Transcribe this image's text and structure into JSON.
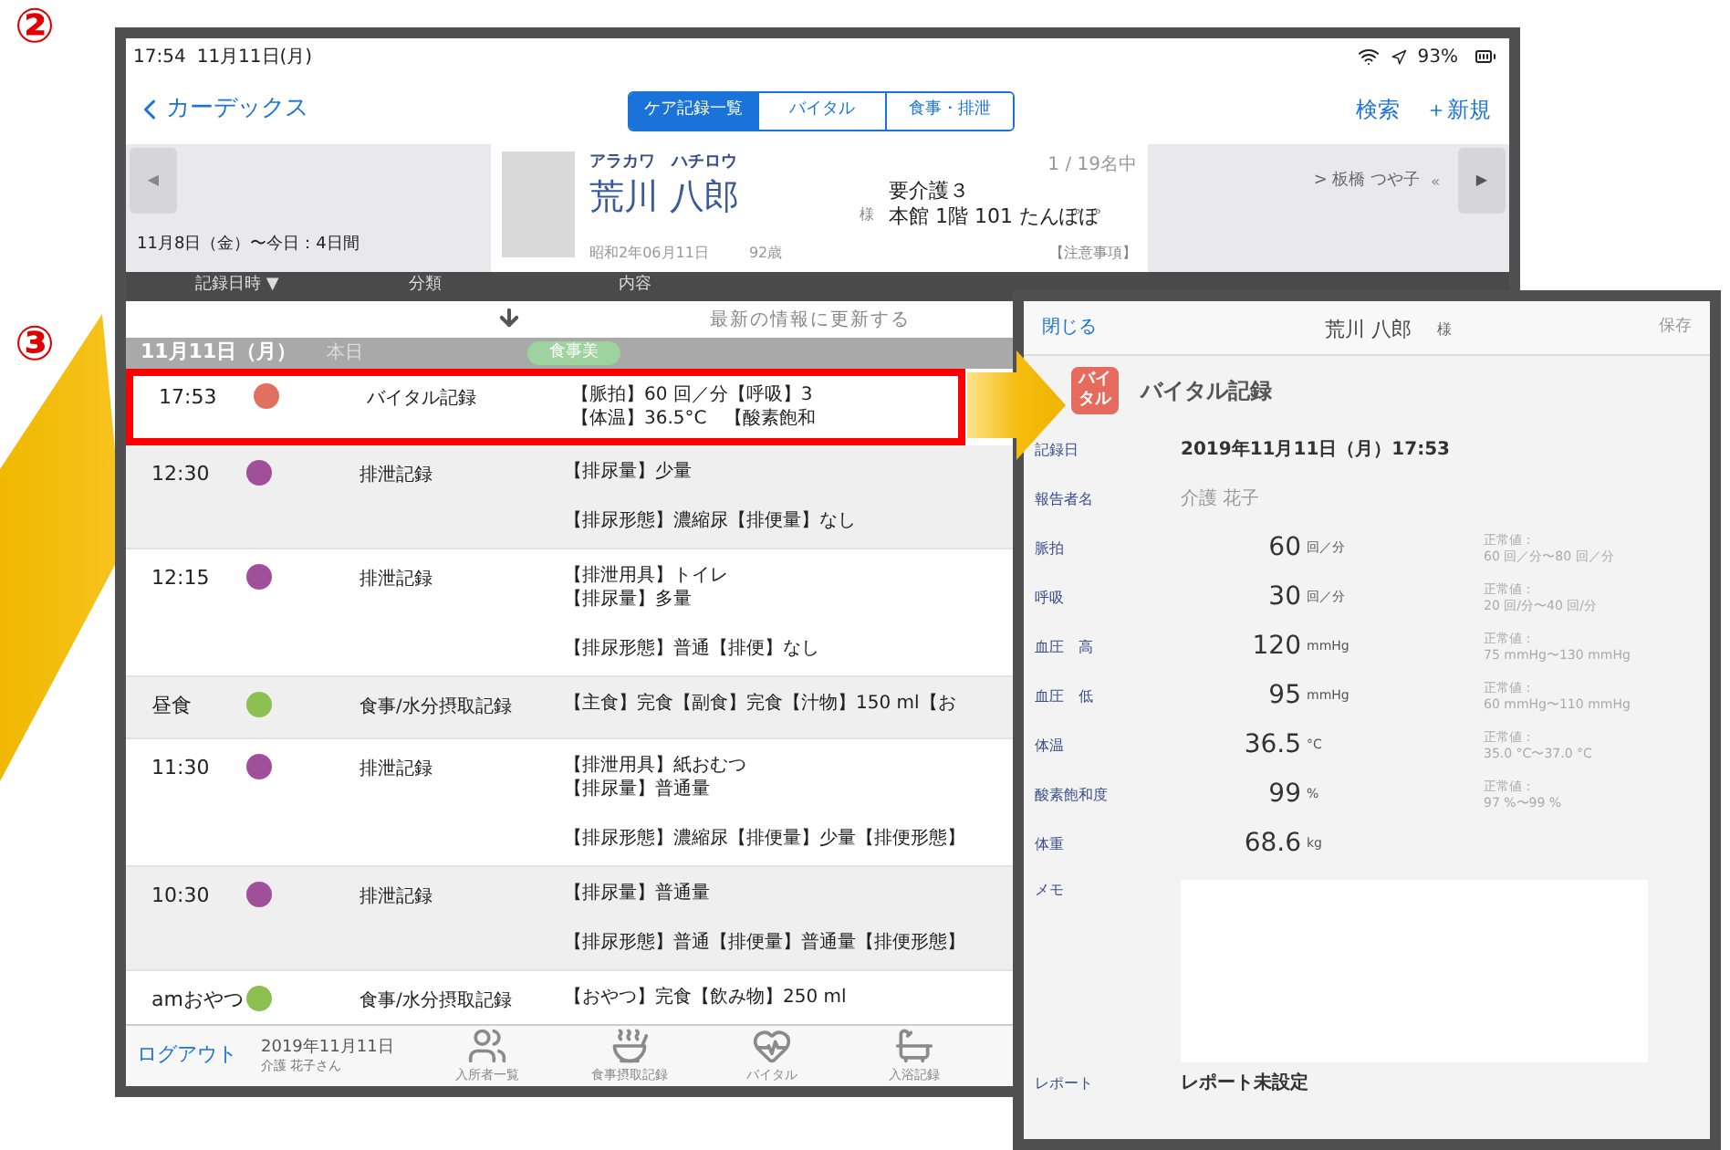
{
  "annotations": [
    {
      "label": "②"
    },
    {
      "label": "③"
    }
  ],
  "status_bar": {
    "time": "17:54",
    "date": "11月11日(月)",
    "battery": "93%"
  },
  "nav": {
    "back": "カーデックス",
    "segments": [
      {
        "label": "ケア記録一覧",
        "selected": true
      },
      {
        "label": "バイタル",
        "selected": false
      },
      {
        "label": "食事・排泄",
        "selected": false
      }
    ],
    "actions": [
      "検索",
      "＋新規"
    ]
  },
  "patient": {
    "prev": "◀",
    "period": "11月8日（金）〜今日：4日間",
    "kana": "アラカワ　ハチロウ",
    "name": "荒川 八郎",
    "birth": "昭和2年06月11日",
    "age": "92歳",
    "honorific": "様",
    "care_level": "要介護３",
    "room": "本館 1階 101 たんぽぽ",
    "position": "1 / 19名中",
    "notes": "【注意事項】",
    "next_name": "> 板橋 つや子",
    "collapse": "«",
    "next": "▶"
  },
  "columns": [
    "記録日時 ▼",
    "分類",
    "内容"
  ],
  "refresh": "最新の情報に更新する",
  "day": {
    "date": "11月11日（月）",
    "today": "本日",
    "badge": "食事美"
  },
  "rows": [
    {
      "time": "17:53",
      "color": "#e07060",
      "category": "バイタル記録",
      "content": [
        [
          "【脈拍】60 回／分【呼吸】3",
          "【体温】36.5°C　【酸素飽和"
        ]
      ],
      "highlighted": true
    },
    {
      "time": "12:30",
      "color": "#a0509a",
      "category": "排泄記録",
      "content": [
        [
          "【排尿量】少量"
        ],
        [
          "【排尿形態】濃縮尿【排便量】なし"
        ]
      ],
      "highlighted": false
    },
    {
      "time": "12:15",
      "color": "#a0509a",
      "category": "排泄記録",
      "content": [
        [
          "【排泄用具】トイレ",
          "【排尿量】多量"
        ],
        [
          "【排尿形態】普通【排便】なし"
        ]
      ],
      "highlighted": false
    },
    {
      "time": "昼食",
      "color": "#8cc050",
      "category": "食事/水分摂取記録",
      "content": [
        [
          "【主食】完食【副食】完食【汁物】150 ml【お"
        ]
      ],
      "highlighted": false
    },
    {
      "time": "11:30",
      "color": "#a0509a",
      "category": "排泄記録",
      "content": [
        [
          "【排泄用具】紙おむつ",
          "【排尿量】普通量"
        ],
        [
          "【排尿形態】濃縮尿【排便量】少量【排便形態】"
        ]
      ],
      "highlighted": false
    },
    {
      "time": "10:30",
      "color": "#a0509a",
      "category": "排泄記録",
      "content": [
        [
          "【排尿量】普通量"
        ],
        [
          "【排尿形態】普通【排便量】普通量【排便形態】"
        ]
      ],
      "highlighted": false
    },
    {
      "time": "amおやつ",
      "color": "#8cc050",
      "category": "食事/水分摂取記録",
      "content": [
        [
          "【おやつ】完食【飲み物】250 ml"
        ]
      ],
      "highlighted": false
    }
  ],
  "bottom_bar": {
    "logout": "ログアウト",
    "date": "2019年11月11日",
    "user": "介護 花子さん",
    "tabs": [
      {
        "label": "入所者一覧",
        "kind": "people"
      },
      {
        "label": "食事摂取記録",
        "kind": "bowl"
      },
      {
        "label": "バイタル",
        "kind": "heart"
      },
      {
        "label": "入浴記録",
        "kind": "bath"
      }
    ]
  },
  "detail": {
    "close": "閉じる",
    "name": "荒川 八郎",
    "honorific": "様",
    "save": "保存",
    "save_disabled": true,
    "badge": "バイタル",
    "title": "バイタル記録",
    "fields": [
      {
        "kind": "text",
        "label": "記録日",
        "value": "2019年11月11日（月）17:53"
      },
      {
        "kind": "muted",
        "label": "報告者名",
        "value": "介護 花子"
      },
      {
        "kind": "measure",
        "label": "脈拍",
        "value": "60",
        "unit": "回／分",
        "range_label": "正常値：",
        "range": "60 回／分〜80 回／分"
      },
      {
        "kind": "measure",
        "label": "呼吸",
        "value": "30",
        "unit": "回／分",
        "range_label": "正常値：",
        "range": "20 回/分〜40 回/分"
      },
      {
        "kind": "measure",
        "label": "血圧　高",
        "value": "120",
        "unit": "mmHg",
        "range_label": "正常値：",
        "range": "75 mmHg〜130 mmHg"
      },
      {
        "kind": "measure",
        "label": "血圧　低",
        "value": "95",
        "unit": "mmHg",
        "range_label": "正常値：",
        "range": "60 mmHg〜110 mmHg"
      },
      {
        "kind": "measure",
        "label": "体温",
        "value": "36.5",
        "unit": "°C",
        "range_label": "正常値：",
        "range": "35.0 °C〜37.0 °C"
      },
      {
        "kind": "measure",
        "label": "酸素飽和度",
        "value": "99",
        "unit": "%",
        "range_label": "正常値：",
        "range": "97 %〜99 %"
      },
      {
        "kind": "measure",
        "label": "体重",
        "value": "68.6",
        "unit": "kg"
      },
      {
        "kind": "memo",
        "label": "メモ"
      },
      {
        "kind": "text",
        "label": "レポート",
        "value": "レポート未設定"
      }
    ]
  }
}
